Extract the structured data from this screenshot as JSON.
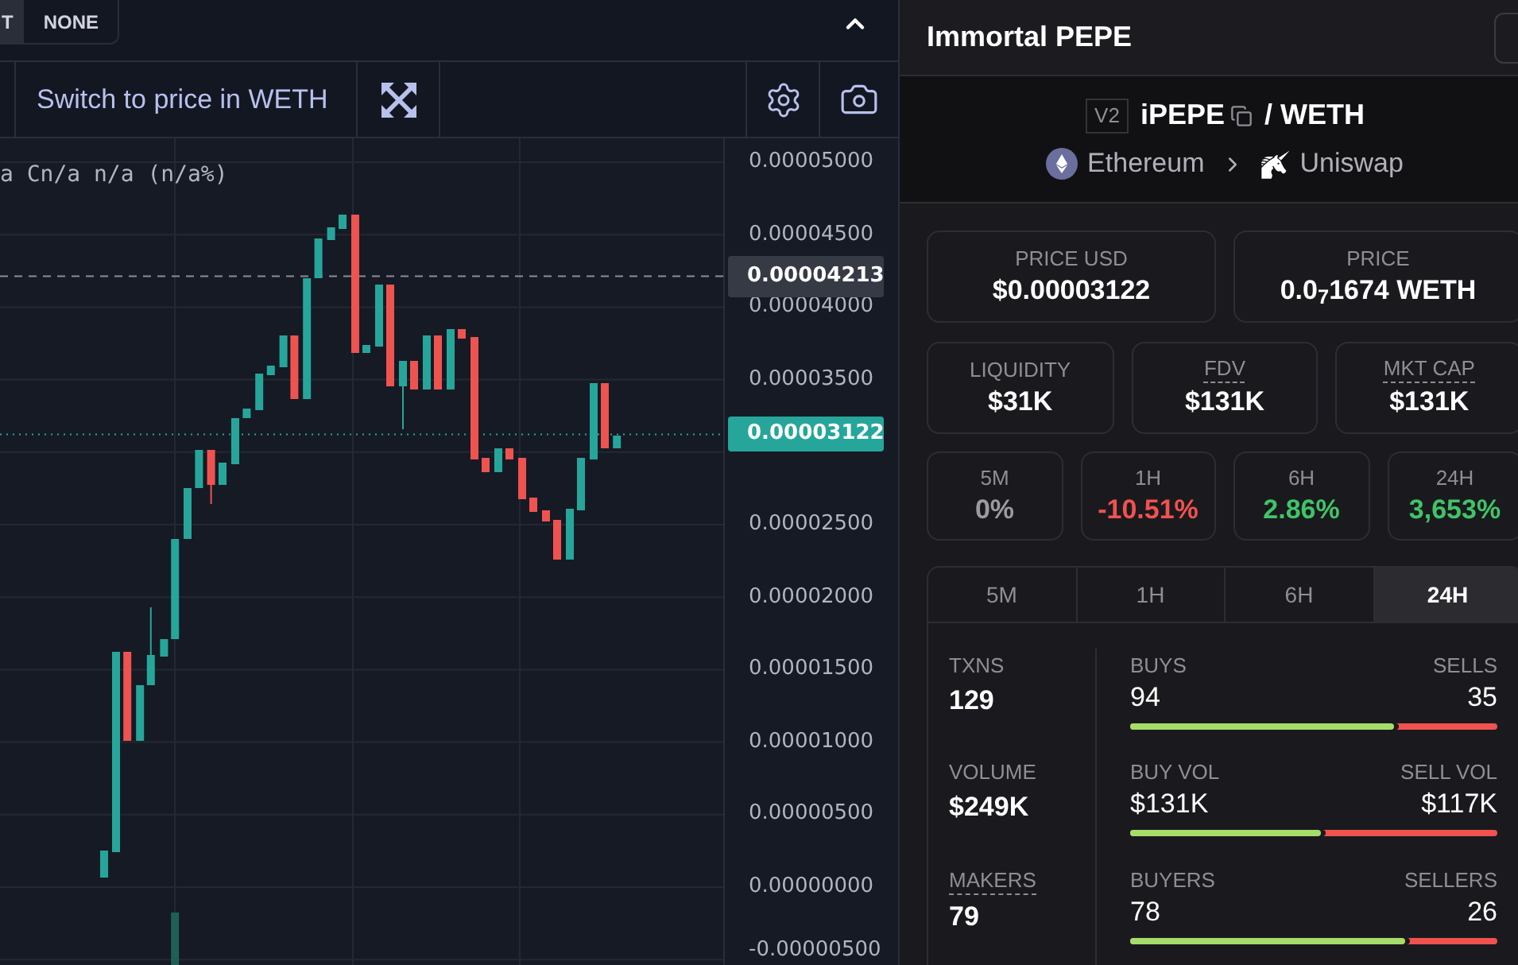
{
  "chart": {
    "mode_toggle": [
      {
        "label": "T",
        "selected": true
      },
      {
        "label": "NONE",
        "selected": false
      }
    ],
    "switch_button": "Switch to price in WETH",
    "legend": "a Cn/a n/a (n/a%)",
    "price_axis": [
      "0.00005000",
      "0.00004500",
      "0.00004000",
      "0.00003500",
      "0.00002500",
      "0.00002000",
      "0.00001500",
      "0.00001000",
      "0.00000500",
      "0.00000000",
      "-0.00000500"
    ],
    "price_markers": [
      {
        "kind": "crosshair",
        "value": "0.00004213"
      },
      {
        "kind": "last_price",
        "value": "0.00003122"
      }
    ]
  },
  "pair": {
    "title": "Immortal PEPE",
    "version": "V2",
    "base": "iPEPE",
    "quote": "/ WETH",
    "chain": "Ethereum",
    "dex": "Uniswap"
  },
  "price_cards": [
    {
      "label": "PRICE USD",
      "value": "$0.00003122"
    },
    {
      "label": "PRICE",
      "value": "0.0$_{7}$1674 WETH"
    }
  ],
  "metric_cards": [
    {
      "label": "LIQUIDITY",
      "value": "$31K",
      "has_tooltip": false
    },
    {
      "label": "FDV",
      "value": "$131K",
      "has_tooltip": true
    },
    {
      "label": "MKT CAP",
      "value": "$131K",
      "has_tooltip": true
    }
  ],
  "change_cards": [
    {
      "label": "5M",
      "value": "0%",
      "color": "#9a9aa0"
    },
    {
      "label": "1H",
      "value": "-10.51%",
      "color": "#f0524f"
    },
    {
      "label": "6H",
      "value": "2.86%",
      "color": "#3fc467"
    },
    {
      "label": "24H",
      "value": "3,653%",
      "color": "#3fc467"
    }
  ],
  "period_tabs": [
    {
      "label": "5M",
      "selected": false
    },
    {
      "label": "1H",
      "selected": false
    },
    {
      "label": "6H",
      "selected": false
    },
    {
      "label": "24H",
      "selected": true
    }
  ],
  "stats": {
    "totals": [
      {
        "label": "TXNS",
        "value": "129",
        "has_tooltip": false
      },
      {
        "label": "VOLUME",
        "value": "$249K",
        "has_tooltip": false
      },
      {
        "label": "MAKERS",
        "value": "79",
        "has_tooltip": true
      }
    ],
    "splits": [
      {
        "left_label": "BUYS",
        "left_value": "94",
        "right_label": "SELLS",
        "right_value": "35",
        "level": 0.72
      },
      {
        "left_label": "BUY VOL",
        "left_value": "$131K",
        "right_label": "SELL VOL",
        "right_value": "$117K",
        "level": 0.52
      },
      {
        "left_label": "BUYERS",
        "left_value": "78",
        "right_label": "SELLERS",
        "right_value": "26",
        "level": 0.75
      }
    ]
  }
}
